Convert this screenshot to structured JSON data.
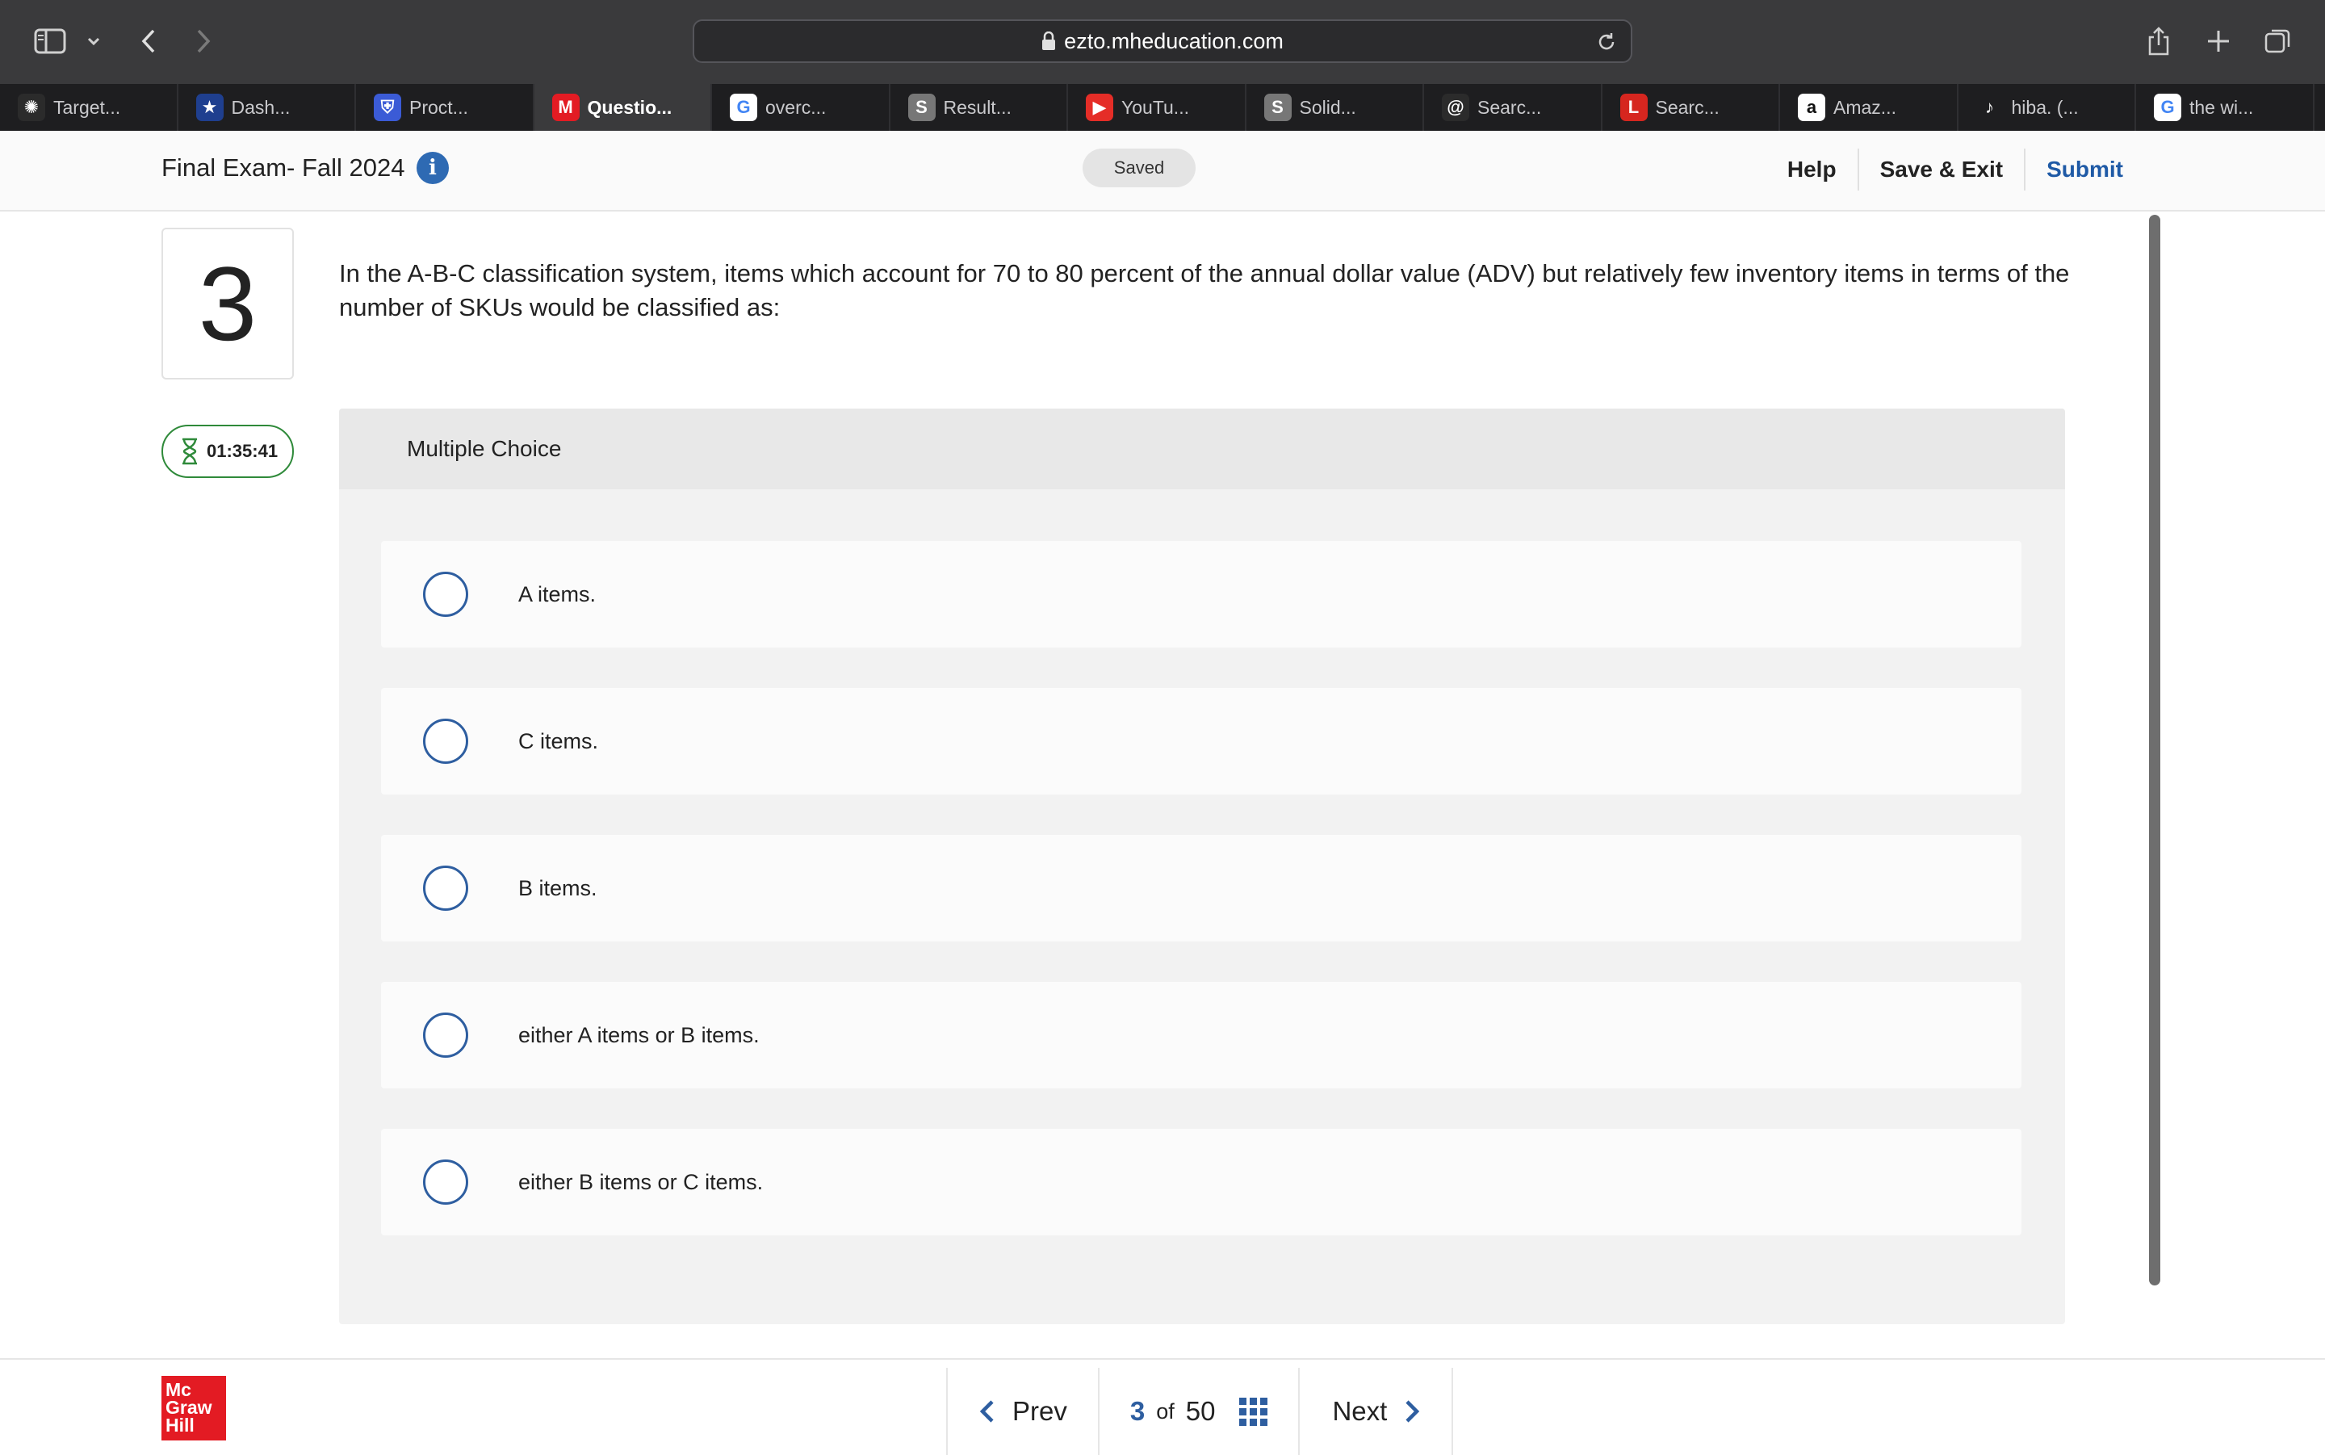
{
  "browser": {
    "url": "ezto.mheducation.com",
    "tabs": [
      {
        "label": "Target...",
        "icon": "openai-icon",
        "color": "#2b2b2b",
        "glyph": "✺"
      },
      {
        "label": "Dash...",
        "icon": "star-badge-icon",
        "color": "#1f3f8f",
        "glyph": "★"
      },
      {
        "label": "Proct...",
        "icon": "shield-icon",
        "color": "#3b5bd6",
        "glyph": "⛨"
      },
      {
        "label": "Questio...",
        "icon": "mcgraw-m-icon",
        "color": "#e31b23",
        "glyph": "M"
      },
      {
        "label": "overc...",
        "icon": "google-icon",
        "color": "#ffffff",
        "glyph": "G"
      },
      {
        "label": "Result...",
        "icon": "s-icon",
        "color": "#777777",
        "glyph": "S"
      },
      {
        "label": "YouTu...",
        "icon": "youtube-icon",
        "color": "#e52d27",
        "glyph": "▶"
      },
      {
        "label": "Solid...",
        "icon": "s-icon",
        "color": "#777777",
        "glyph": "S"
      },
      {
        "label": "Searc...",
        "icon": "at-icon",
        "color": "#2b2b2b",
        "glyph": "@"
      },
      {
        "label": "Searc...",
        "icon": "lego-icon",
        "color": "#d6261f",
        "glyph": "L"
      },
      {
        "label": "Amaz...",
        "icon": "amazon-icon",
        "color": "#ffffff",
        "glyph": "a"
      },
      {
        "label": "hiba. (...",
        "icon": "tiktok-icon",
        "color": "#1e1e20",
        "glyph": "♪"
      },
      {
        "label": "the wi...",
        "icon": "google-icon",
        "color": "#ffffff",
        "glyph": "G"
      }
    ],
    "active_tab": 3
  },
  "header": {
    "title": "Final Exam- Fall 2024",
    "info_glyph": "i",
    "status": "Saved",
    "help": "Help",
    "save_exit": "Save & Exit",
    "submit": "Submit"
  },
  "question": {
    "number": "3",
    "text": "In the A-B-C classification system, items which account for 70 to 80 percent of the annual dollar value (ADV) but relatively few inventory items in terms of the number of SKUs would be classified as:",
    "type": "Multiple Choice",
    "options": [
      "A items.",
      "C items.",
      "B items.",
      "either A items or B items.",
      "either B items or C items."
    ]
  },
  "timer": {
    "value": "01:35:41"
  },
  "footer": {
    "logo_lines": [
      "Mc",
      "Graw",
      "Hill"
    ],
    "prev": "Prev",
    "current": "3",
    "of": "of",
    "total": "50",
    "next": "Next"
  }
}
